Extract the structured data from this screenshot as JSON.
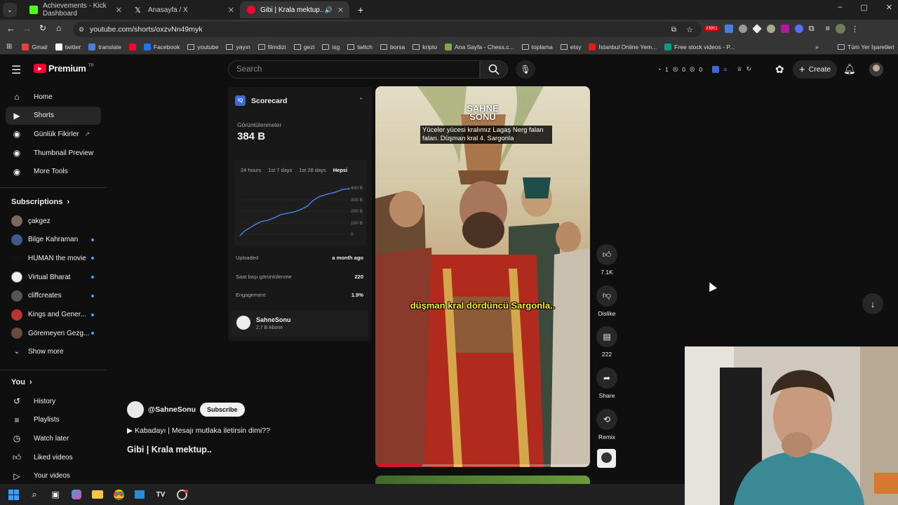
{
  "browser": {
    "tabs": [
      {
        "title": "Achievements - Kick Dashboard",
        "favicon_color": "#53fc18"
      },
      {
        "title": "Anasayfa / X",
        "favicon_color": "#ffffff"
      },
      {
        "title": "Gibi | Krala mektup.. - YouT",
        "favicon_color": "#ff0033"
      }
    ],
    "url": "youtube.com/shorts/oxzvNn49myk",
    "ext_badge": "23951",
    "bookmarks": [
      "Gmail",
      "twitter",
      "translate",
      "",
      "Facebook",
      "youtube",
      "yayın",
      "filmdizi",
      "gezi",
      "isg",
      "twitch",
      "borsa",
      "kripto",
      "Ana Sayfa - Chess.c...",
      "toplama",
      "etsy",
      "İstanbul Online Yem...",
      "Free stock videos - P..."
    ],
    "bookmarks_more": "Tüm Yer İşaretleri"
  },
  "header": {
    "logo": "Premium",
    "logo_region": "TR",
    "search_placeholder": "Search",
    "counters": [
      "1",
      "0",
      "0"
    ],
    "create_label": "Create"
  },
  "sidebar": {
    "main": [
      {
        "label": "Home",
        "icon": "home-icon"
      },
      {
        "label": "Shorts",
        "icon": "shorts-icon"
      },
      {
        "label": "Günlük Fikirler",
        "icon": "link-icon"
      },
      {
        "label": "Thumbnail Preview",
        "icon": "app-icon"
      },
      {
        "label": "More Tools",
        "icon": "app-icon"
      }
    ],
    "subscriptions_title": "Subscriptions",
    "subscriptions": [
      {
        "label": "çakgez",
        "color": "#7a6a5a"
      },
      {
        "label": "Bilge Kahraman",
        "color": "#3d5a8a"
      },
      {
        "label": "HUMAN the movie",
        "color": "#111111"
      },
      {
        "label": "Virtual Bharat",
        "color": "#eeeeee"
      },
      {
        "label": "cliffcreates",
        "color": "#555555"
      },
      {
        "label": "Kings and Gener...",
        "color": "#b33"
      },
      {
        "label": "Göremeyen Gezg...",
        "color": "#6a4a3a"
      }
    ],
    "show_more": "Show more",
    "you_title": "You",
    "you_items": [
      {
        "label": "History",
        "icon": "history-icon"
      },
      {
        "label": "Playlists",
        "icon": "playlist-icon"
      },
      {
        "label": "Watch later",
        "icon": "clock-icon"
      },
      {
        "label": "Liked videos",
        "icon": "like-icon"
      },
      {
        "label": "Your videos",
        "icon": "video-icon"
      }
    ]
  },
  "scorecard": {
    "title": "Scorecard",
    "views_label": "Görüntülenmeler",
    "views_value": "384 B",
    "ranges": [
      "24 hours",
      "1st 7 days",
      "1st 28 days",
      "Hepsi"
    ],
    "y_ticks": [
      "400 B",
      "300 B",
      "200 B",
      "100 B",
      "0"
    ],
    "rows": [
      {
        "label": "Uploaded",
        "value": "a month ago"
      },
      {
        "label": "Saat başı görüntülenme",
        "value": "220"
      },
      {
        "label": "Engagement",
        "value": "1.9%"
      }
    ],
    "channel_name": "SahneSonu",
    "channel_subs": "2,7 B Abone"
  },
  "video": {
    "watermark_line1": "SAHNE",
    "watermark_line2": "SONU",
    "caption_top": "Yüceler yücesi kralımız Lagaş Nerg falan falan. Düşman kral 4. Sargonla",
    "subtitle": "düşman kral dördüncü Sargonla..",
    "progress": 0.22
  },
  "actions": [
    {
      "label": "7.1K",
      "icon": "like-icon"
    },
    {
      "label": "Dislike",
      "icon": "dislike-icon"
    },
    {
      "label": "222",
      "icon": "comment-icon"
    },
    {
      "label": "Share",
      "icon": "share-icon"
    },
    {
      "label": "Remix",
      "icon": "remix-icon"
    }
  ],
  "channel": {
    "handle": "@SahneSonu",
    "subscribe_label": "Subscribe",
    "playlist_line": "▶ Kabadayı | Mesajı mutlaka iletirsin dimi??",
    "title": "Gibi | Krala mektup.."
  }
}
